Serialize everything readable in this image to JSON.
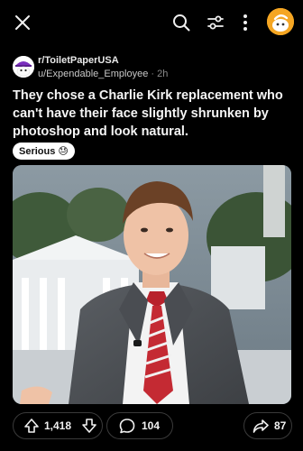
{
  "header": {
    "close_icon": "close-icon",
    "search_icon": "search-icon",
    "sort_icon": "sort-icon",
    "more_icon": "more-vertical-icon",
    "avatar_icon": "user-avatar"
  },
  "post": {
    "subreddit": "r/ToiletPaperUSA",
    "username": "u/Expendable_Employee",
    "separator": "·",
    "age": "2h",
    "title": "They chose a Charlie Kirk replacement who can't have their face slightly shrunken by photoshop and look natural.",
    "flair": "Serious",
    "flair_emoji": "😓"
  },
  "actions": {
    "votes": "1,418",
    "comments": "104",
    "shares": "87"
  }
}
